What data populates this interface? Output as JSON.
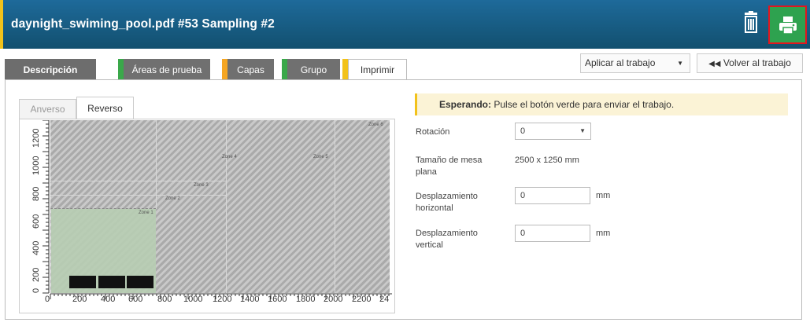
{
  "header": {
    "title": "daynight_swiming_pool.pdf #53 Sampling #2",
    "trash_icon": "trash-icon",
    "print_icon": "printer-icon",
    "print_button_color": "#2ea24f",
    "accent_color": "#f2c21b"
  },
  "tabs": [
    {
      "label": "Descripción",
      "stripe": ""
    },
    {
      "label": "Áreas de prueba",
      "stripe": "#3aa84a"
    },
    {
      "label": "Capas",
      "stripe": "#f5a623"
    },
    {
      "label": "Grupo",
      "stripe": "#3aa84a"
    },
    {
      "label": "Imprimir",
      "stripe": "#f2c21b"
    }
  ],
  "toolbar": {
    "apply_select": "Aplicar al trabajo",
    "back_button": "Volver al trabajo"
  },
  "preview": {
    "side_tabs": [
      "Anverso",
      "Reverso"
    ],
    "selected_side": "Reverso",
    "zones": [
      "Zone 1",
      "Zone 2",
      "Zone 3",
      "Zone 4",
      "Zone 5",
      "Zone 6"
    ],
    "x_ticks": [
      "0",
      "200",
      "400",
      "600",
      "800",
      "1000",
      "1200",
      "1400",
      "1600",
      "1800",
      "2000",
      "2200",
      "24"
    ],
    "y_ticks": [
      "0",
      "200",
      "400",
      "600",
      "800",
      "1000",
      "1200"
    ]
  },
  "status": {
    "label": "Esperando:",
    "message": "Pulse el botón verde para enviar el trabajo."
  },
  "form": {
    "rotation_label": "Rotación",
    "rotation_value": "0",
    "table_size_label": "Tamaño de mesa plana",
    "table_size_value": "2500 x 1250 mm",
    "h_offset_label": "Desplazamiento horizontal",
    "h_offset_value": "0",
    "v_offset_label": "Desplazamiento vertical",
    "v_offset_value": "0",
    "unit": "mm"
  }
}
